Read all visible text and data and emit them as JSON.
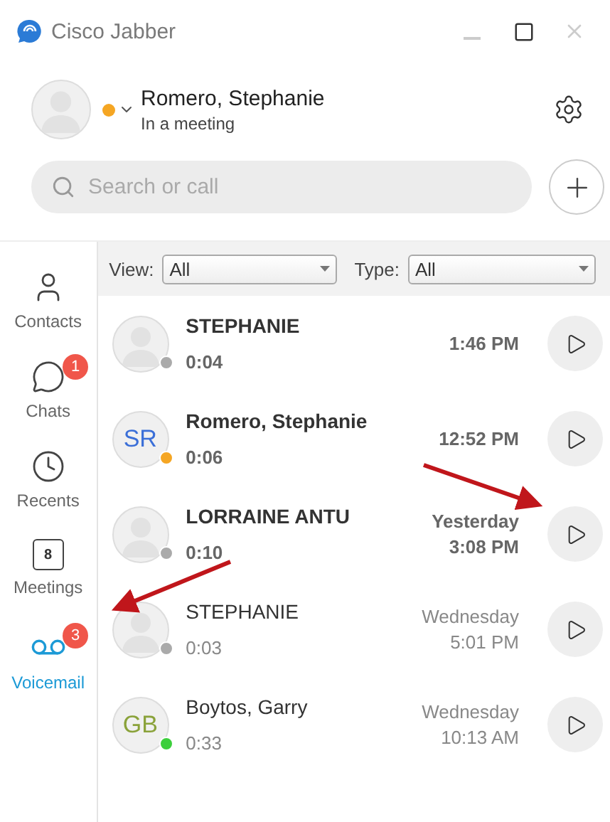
{
  "window": {
    "title": "Cisco Jabber"
  },
  "profile": {
    "name": "Romero, Stephanie",
    "status": "In a meeting",
    "color": "#f5a623"
  },
  "search": {
    "placeholder": "Search or call"
  },
  "nav": [
    {
      "kind": "contacts",
      "label": "Contacts",
      "selected": false
    },
    {
      "kind": "chats",
      "label": "Chats",
      "selected": false,
      "badge": "1"
    },
    {
      "kind": "recents",
      "label": "Recents",
      "selected": false
    },
    {
      "kind": "meetings",
      "label": "Meetings",
      "selected": false,
      "icon_text": "8"
    },
    {
      "kind": "voicemail",
      "label": "Voicemail",
      "selected": true,
      "badge": "3"
    }
  ],
  "filters": [
    {
      "label": "View:",
      "value": "All"
    },
    {
      "label": "Type:",
      "value": "All"
    }
  ],
  "voicemails": [
    {
      "name": "STEPHANIE",
      "duration": "0:04",
      "time": [
        "1:46 PM"
      ],
      "unread": true,
      "avatar": {
        "kind": "silhouette"
      },
      "color": "#aaaaaa"
    },
    {
      "name": "Romero, Stephanie",
      "duration": "0:06",
      "time": [
        "12:52 PM"
      ],
      "unread": true,
      "avatar": {
        "kind": "initials",
        "text": "SR",
        "color": "#3b6fd8"
      },
      "color": "#f5a623"
    },
    {
      "name": "LORRAINE ANTU",
      "duration": "0:10",
      "time": [
        "Yesterday",
        "3:08 PM"
      ],
      "unread": true,
      "avatar": {
        "kind": "silhouette"
      },
      "color": "#aaaaaa"
    },
    {
      "name": "STEPHANIE",
      "duration": "0:03",
      "time": [
        "Wednesday",
        "5:01 PM"
      ],
      "unread": false,
      "avatar": {
        "kind": "silhouette"
      },
      "color": "#aaaaaa"
    },
    {
      "name": "Boytos, Garry",
      "duration": "0:33",
      "time": [
        "Wednesday",
        "10:13 AM"
      ],
      "unread": false,
      "avatar": {
        "kind": "initials",
        "text": "GB",
        "color": "#8aa23a"
      },
      "color": "#3ccf3c"
    }
  ]
}
